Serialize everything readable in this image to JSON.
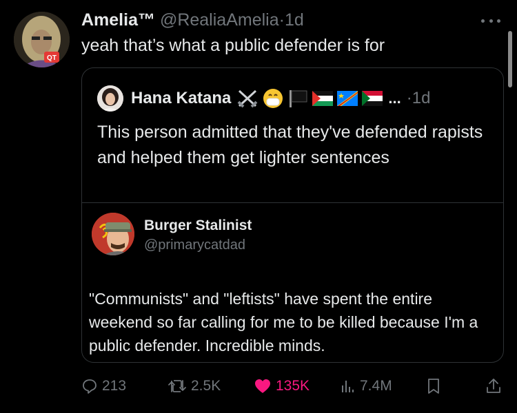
{
  "tweet": {
    "author_name": "Amelia™",
    "handle": "@RealiaAmelia",
    "separator": "·",
    "time": "1d",
    "text": "yeah that’s what a public defender is for",
    "avatar_badge": "QT"
  },
  "quote": {
    "author_name": "Hana Katana",
    "emoji_flags": [
      "crossed-swords",
      "mask-face",
      "black-flag",
      "palestine-flag",
      "congo-flag",
      "sudan-flag"
    ],
    "ellipsis": "...",
    "separator": "·",
    "time": "1d",
    "text": "This person admitted that they've defended rapists and helped them get lighter sentences"
  },
  "embedded": {
    "author_name": "Burger Stalinist",
    "handle": "@primarycatdad",
    "text": "\"Communists\" and \"leftists\" have spent the entire weekend so far calling for me to be killed because I'm a public defender. Incredible minds."
  },
  "actions": {
    "replies": "213",
    "retweets": "2.5K",
    "likes": "135K",
    "views": "7.4M"
  },
  "colors": {
    "background": "#000000",
    "text": "#e7e9ea",
    "muted": "#71767b",
    "like_pink": "#f91880",
    "border": "#2f3336"
  }
}
